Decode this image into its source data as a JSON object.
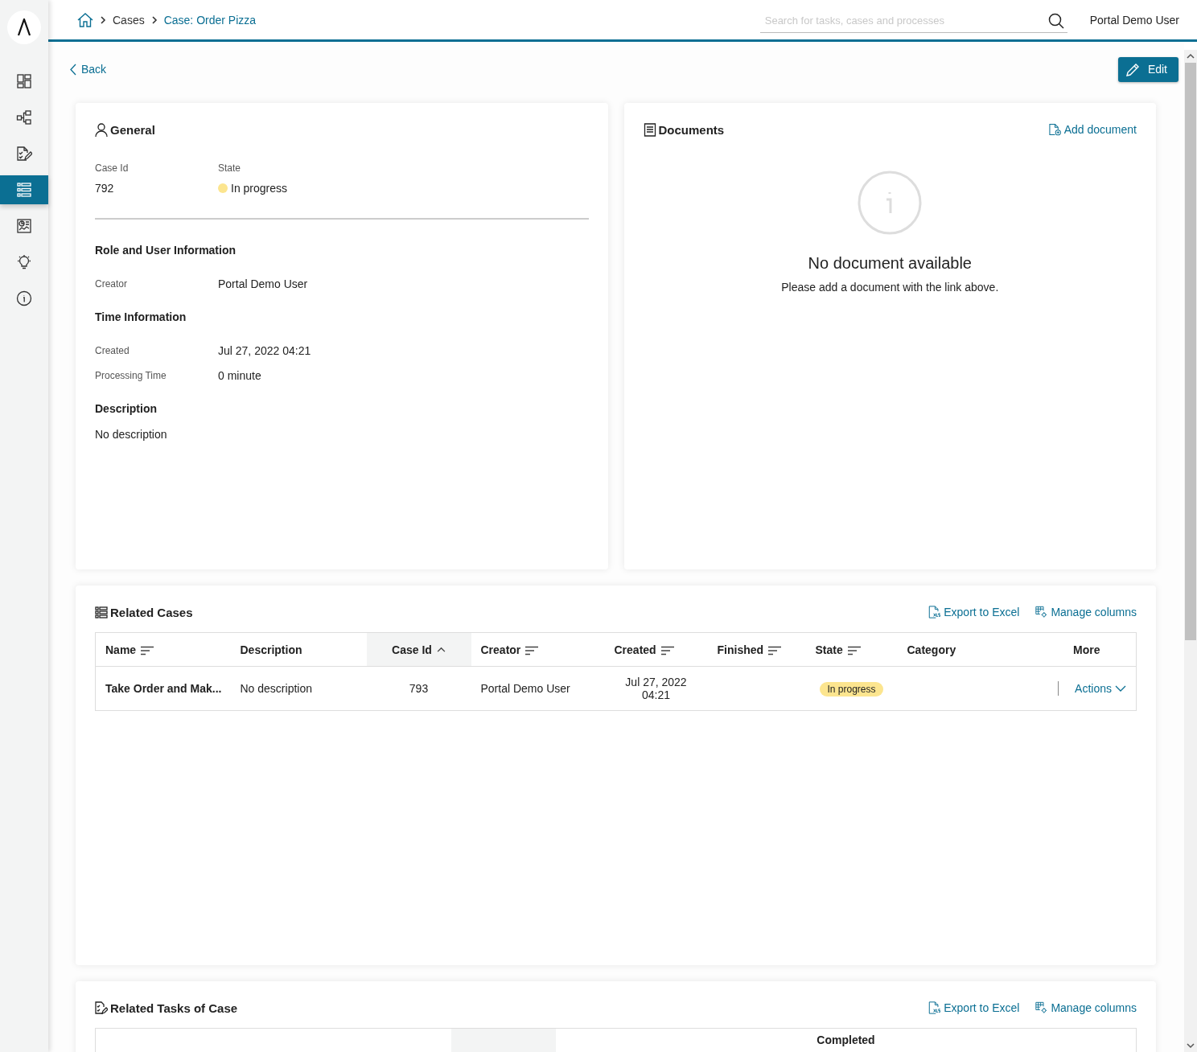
{
  "sidebar": {
    "items": [
      {
        "kind": "dashboard",
        "selected": false
      },
      {
        "kind": "process",
        "selected": false
      },
      {
        "kind": "task",
        "selected": false
      },
      {
        "kind": "case",
        "selected": true
      },
      {
        "kind": "statistics",
        "selected": false
      },
      {
        "kind": "idea",
        "selected": false
      },
      {
        "kind": "info",
        "selected": false
      }
    ]
  },
  "header": {
    "breadcrumb": [
      {
        "label": "Cases",
        "current": false
      },
      {
        "label": "Case: Order Pizza",
        "current": true
      }
    ],
    "search": {
      "placeholder": "Search for tasks, cases and processes"
    },
    "user": "Portal Demo User"
  },
  "toolbar": {
    "back": "Back",
    "edit": "Edit"
  },
  "general": {
    "title": "General",
    "summary": [
      {
        "label": "Case Id",
        "value": "792",
        "kind": "text"
      },
      {
        "label": "State",
        "value": "In progress",
        "kind": "state"
      }
    ],
    "sections": [
      {
        "title": "Role and User Information",
        "fields": [
          {
            "label": "Creator",
            "value": "Portal Demo User"
          }
        ]
      },
      {
        "title": "Time Information",
        "fields": [
          {
            "label": "Created",
            "value": "Jul 27, 2022 04:21"
          },
          {
            "label": "Processing Time",
            "value": "0 minute"
          }
        ]
      },
      {
        "title": "Description",
        "text": "No description"
      }
    ]
  },
  "documents": {
    "title": "Documents",
    "add_link": "Add document",
    "empty": {
      "heading": "No document available",
      "message": "Please add a document with the link above."
    }
  },
  "related_cases": {
    "title": "Related Cases",
    "export": "Export to Excel",
    "manage": "Manage columns",
    "table": {
      "columns": [
        {
          "label": "Name",
          "sortable": true,
          "sorted": false
        },
        {
          "label": "Description",
          "sortable": false,
          "sorted": false
        },
        {
          "label": "Case Id",
          "sortable": true,
          "sorted": true
        },
        {
          "label": "Creator",
          "sortable": true,
          "sorted": false
        },
        {
          "label": "Created",
          "sortable": true,
          "sorted": false
        },
        {
          "label": "Finished",
          "sortable": true,
          "sorted": false
        },
        {
          "label": "State",
          "sortable": true,
          "sorted": false
        },
        {
          "label": "Category",
          "sortable": false,
          "sorted": false
        },
        {
          "label": "More",
          "sortable": false,
          "sorted": false
        }
      ],
      "rows": [
        {
          "name": "Take Order and Mak...",
          "description": "No description",
          "case_id": "793",
          "creator": "Portal Demo User",
          "created": "Jul 27, 2022 04:21",
          "state": "In progress",
          "action": "Actions"
        }
      ]
    }
  },
  "related_tasks": {
    "title": "Related Tasks of Case",
    "export": "Export to Excel",
    "manage": "Manage columns",
    "table": {
      "columns": [
        {
          "label": "Completed"
        }
      ]
    }
  }
}
